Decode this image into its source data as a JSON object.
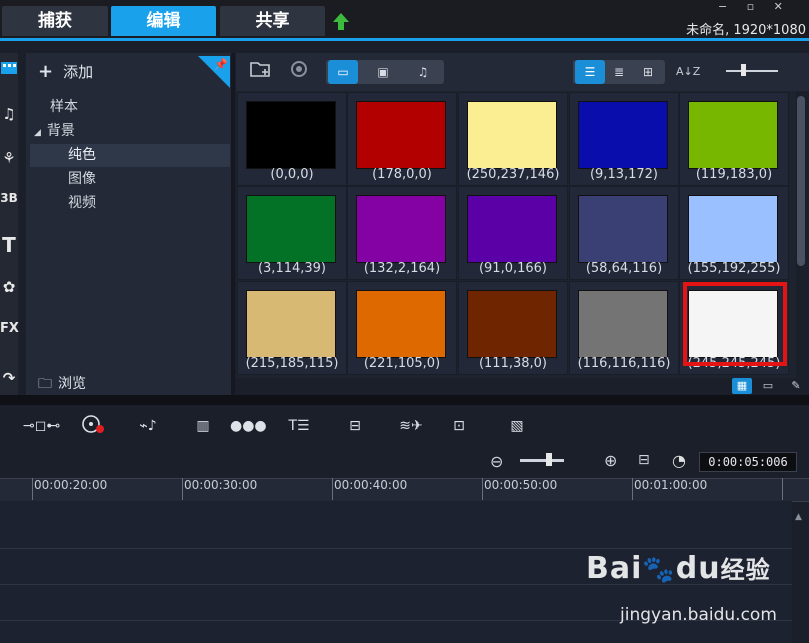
{
  "tabs": {
    "capture": "捕获",
    "edit": "编辑",
    "share": "共享"
  },
  "window": {
    "controls": "− ▫ ✕",
    "project_title": "未命名, 1920*1080"
  },
  "left_strip_icons": [
    "media-icon",
    "music-icon",
    "transition-icon",
    "3d-title-icon",
    "title-icon",
    "graphics-icon",
    "filter-icon",
    "path-icon"
  ],
  "tree": {
    "add_label": "添加",
    "items": [
      {
        "label": "样本"
      },
      {
        "label": "背景",
        "expanded": true
      },
      {
        "label": "纯色",
        "selected": true
      },
      {
        "label": "图像"
      },
      {
        "label": "视频"
      }
    ],
    "browse_label": "浏览"
  },
  "toolbar": {
    "sort_label": "A↓Z"
  },
  "swatches": [
    {
      "label": "(0,0,0)",
      "color": "#000000"
    },
    {
      "label": "(178,0,0)",
      "color": "#b20000"
    },
    {
      "label": "(250,237,146)",
      "color": "#faed92"
    },
    {
      "label": "(9,13,172)",
      "color": "#090dac"
    },
    {
      "label": "(119,183,0)",
      "color": "#77b700"
    },
    {
      "label": "(3,114,39)",
      "color": "#037227"
    },
    {
      "label": "(132,2,164)",
      "color": "#8402a4"
    },
    {
      "label": "(91,0,166)",
      "color": "#5b00a6"
    },
    {
      "label": "(58,64,116)",
      "color": "#3a4074"
    },
    {
      "label": "(155,192,255)",
      "color": "#9bc0ff"
    },
    {
      "label": "(215,185,115)",
      "color": "#d7b973"
    },
    {
      "label": "(221,105,0)",
      "color": "#dd6900"
    },
    {
      "label": "(111,38,0)",
      "color": "#6f2600"
    },
    {
      "label": "(116,116,116)",
      "color": "#747474"
    },
    {
      "label": "(245,245,245)",
      "color": "#f5f5f5",
      "highlighted": true
    }
  ],
  "timeline": {
    "timecode": "0:00:05:006",
    "ruler_ticks": [
      "00:00:20:00",
      "00:00:30:00",
      "00:00:40:00",
      "00:00:50:00",
      "00:01:00:00"
    ]
  },
  "watermark": {
    "logo_text_1": "Bai",
    "logo_text_2": "du",
    "logo_text_3": "经验",
    "url": "jingyan.baidu.com"
  }
}
